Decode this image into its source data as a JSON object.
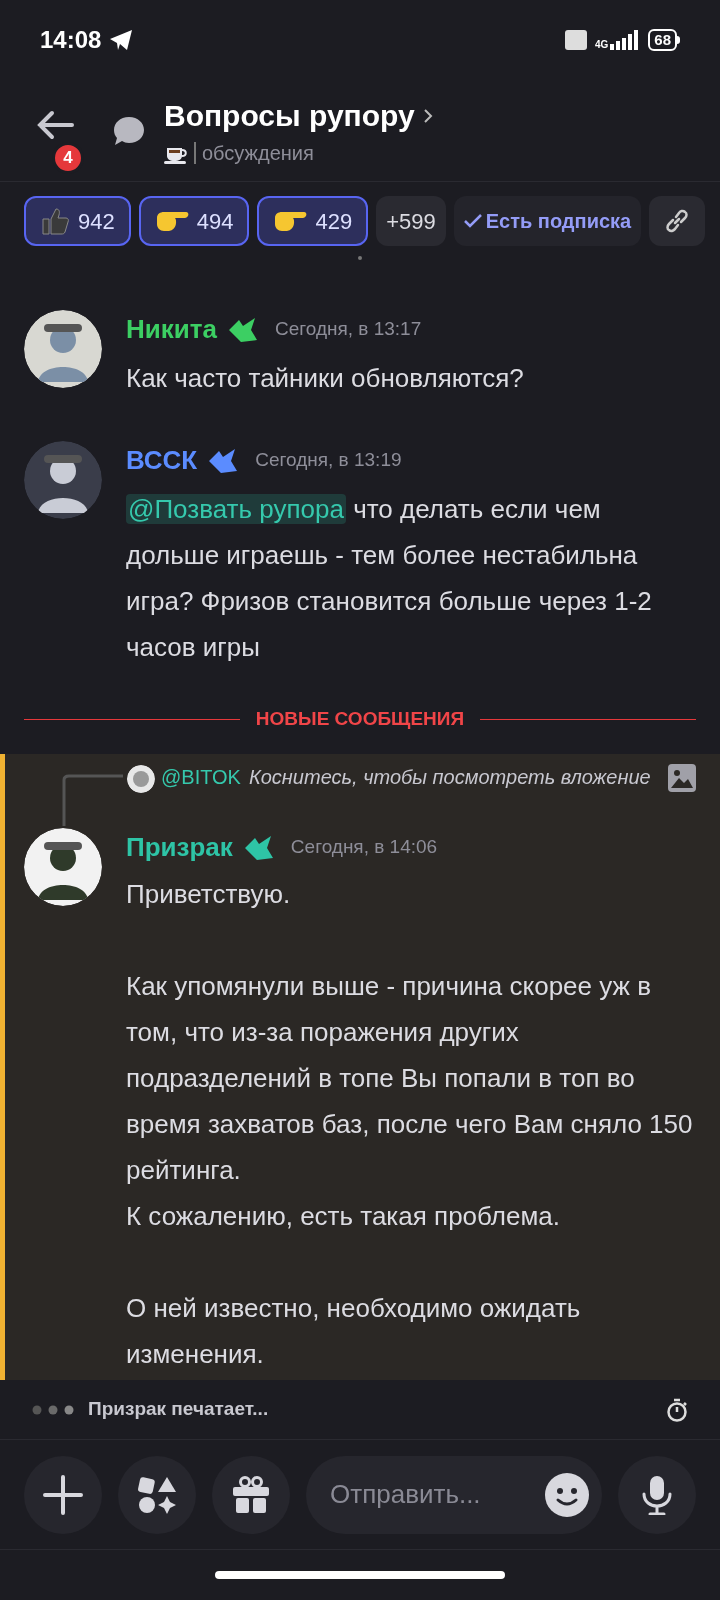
{
  "status_bar": {
    "time": "14:08",
    "network": "4G",
    "battery": "68"
  },
  "header": {
    "title": "Вопросы рупору",
    "badge": "4",
    "subtitle": "обсуждения"
  },
  "reactions": [
    {
      "kind": "thumb",
      "count": "942",
      "selected": true
    },
    {
      "kind": "point",
      "count": "494",
      "selected": true
    },
    {
      "kind": "point",
      "count": "429",
      "selected": true
    }
  ],
  "more_reactions": "+599",
  "subscribe": {
    "label": "Есть подписка"
  },
  "messages": [
    {
      "author": "Никита",
      "color": "#3ccf63",
      "time": "Сегодня, в 13:17",
      "text": "Как часто тайники обновляются?"
    },
    {
      "author": "ВССК",
      "color": "#5b8cff",
      "time": "Сегодня, в 13:19",
      "mention": "@Позвать рупора",
      "text": "что делать если чем дольше играешь - тем более нестабильна игра? Фризов становится больше через 1-2 часов игры"
    }
  ],
  "new_divider": "НОВЫЕ СООБЩЕНИЯ",
  "highlighted": {
    "reply": {
      "author": "@BITOK",
      "text": "Коснитесь, чтобы посмотреть вложение"
    },
    "author": "Призрак",
    "color": "#2ec4a6",
    "time": "Сегодня, в 14:06",
    "paragraphs": [
      "Приветствую.",
      "Как упомянули выше - причина скорее уж в том, что из-за поражения других подразделений в топе Вы попали в топ во время захватов баз, после чего Вам сняло 150 рейтинга.\nК сожалению, есть такая проблема.",
      "О ней известно, необходимо ожидать изменения."
    ]
  },
  "typing": "Призрак печатает...",
  "composer": {
    "placeholder": "Отправить..."
  }
}
